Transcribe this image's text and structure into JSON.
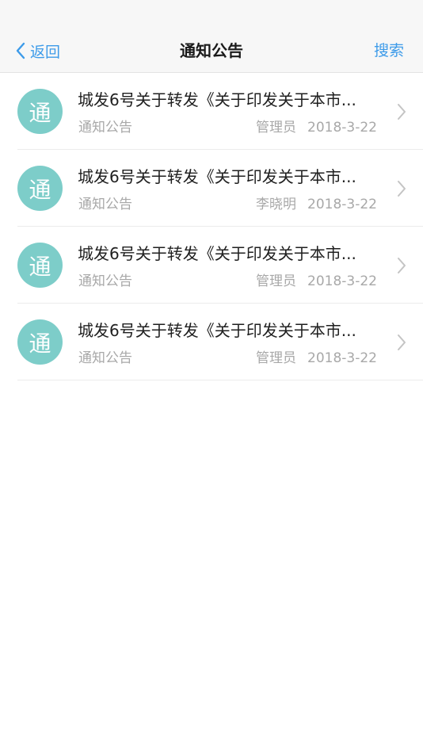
{
  "nav": {
    "back_label": "返回",
    "title": "通知公告",
    "search_label": "搜索"
  },
  "accent_color": "#3d9be9",
  "avatar_color": "#7dcdc9",
  "items": [
    {
      "avatar_text": "通",
      "title": "城发6号关于转发《关于印发关于本市...",
      "category": "通知公告",
      "author": "管理员",
      "date": "2018-3-22"
    },
    {
      "avatar_text": "通",
      "title": "城发6号关于转发《关于印发关于本市...",
      "category": "通知公告",
      "author": "李晓明",
      "date": "2018-3-22"
    },
    {
      "avatar_text": "通",
      "title": "城发6号关于转发《关于印发关于本市...",
      "category": "通知公告",
      "author": "管理员",
      "date": "2018-3-22"
    },
    {
      "avatar_text": "通",
      "title": "城发6号关于转发《关于印发关于本市...",
      "category": "通知公告",
      "author": "管理员",
      "date": "2018-3-22"
    }
  ]
}
